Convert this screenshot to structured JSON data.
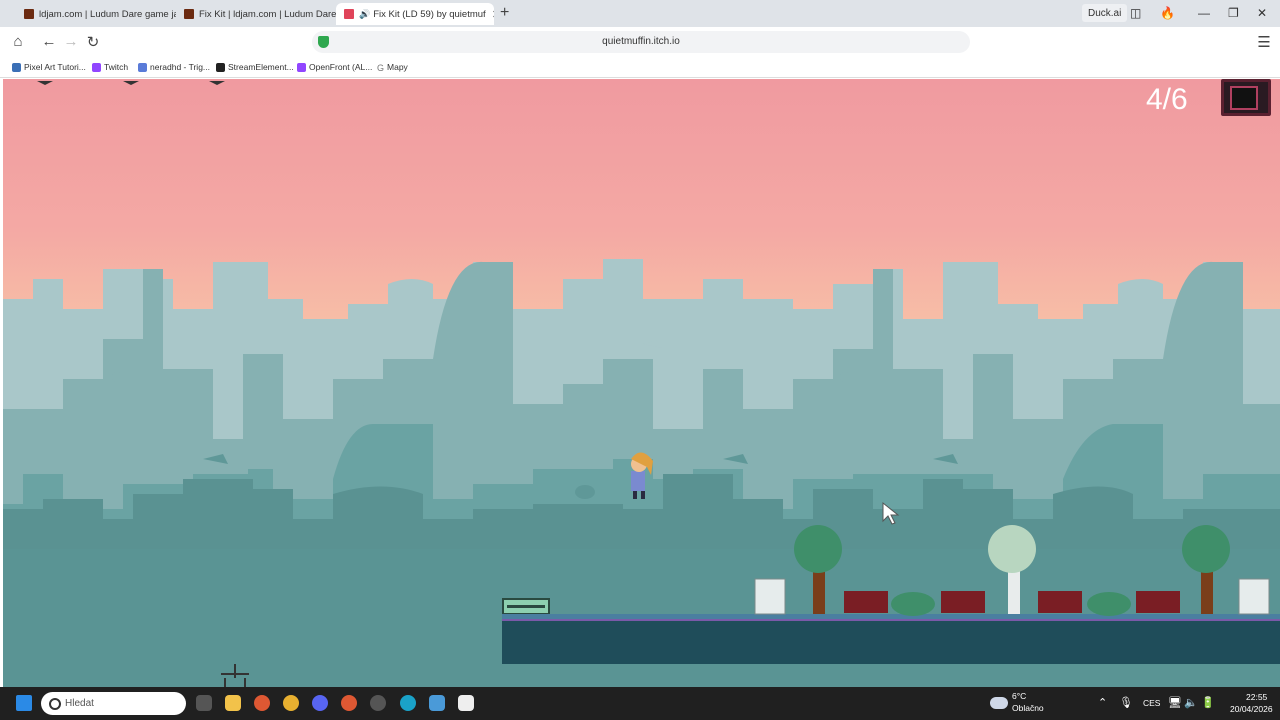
{
  "browser": {
    "tabs": [
      {
        "title": "ldjam.com | Ludum Dare game jam",
        "active": false
      },
      {
        "title": "Fix Kit | ldjam.com | Ludum Dare g",
        "active": false
      },
      {
        "title": "Fix Kit (LD 59) by quietmuf",
        "active": true
      }
    ],
    "new_tab": "+",
    "duck_ai": "Duck.ai",
    "url": "quietmuffin.itch.io",
    "bookmarks": [
      {
        "label": "Pixel Art Tutori...",
        "color": "#3b6fb6"
      },
      {
        "label": "Twitch",
        "color": "#9146ff"
      },
      {
        "label": "neradhd - Trig...",
        "color": "#5a7bd8"
      },
      {
        "label": "StreamElement...",
        "color": "#222222"
      },
      {
        "label": "OpenFront (AL...",
        "color": "#9146ff"
      },
      {
        "label": "Mapy",
        "color": "#777777"
      }
    ]
  },
  "game": {
    "counter": "4/6"
  },
  "taskbar": {
    "search_placeholder": "Hledat",
    "weather_temp": "6°C",
    "weather_desc": "Oblačno",
    "language": "CES",
    "time": "22:55",
    "date": "20/04/2026"
  },
  "colors": {
    "sky_top": "#f09aa0",
    "sky_bottom": "#fde7b0",
    "city_far": "#a9c7c9",
    "city_mid": "#86b1b2",
    "city_near": "#5f9898",
    "platform": "#1e4f5c",
    "taskbar": "#202020"
  }
}
